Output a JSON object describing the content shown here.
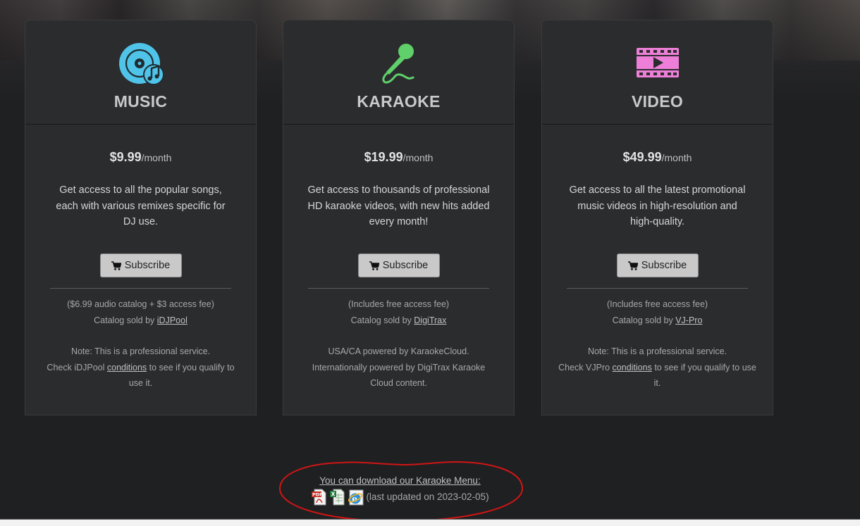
{
  "plans": [
    {
      "title": "MUSIC",
      "icon": "vinyl-music-icon",
      "price": "$9.99",
      "per": "/month",
      "description": "Get access to all the popular songs, each with various remixes specific for DJ use.",
      "subscribe_label": "Subscribe",
      "fee_note": "($6.99 audio catalog + $3 access fee)",
      "sold_by_prefix": "Catalog sold by ",
      "sold_by_link": "iDJPool",
      "note_line1": "Note: This is a professional service.",
      "note_line2_prefix": "Check iDJPool ",
      "note_link": "conditions",
      "note_line2_suffix": " to see if you qualify to use it."
    },
    {
      "title": "KARAOKE",
      "icon": "microphone-icon",
      "price": "$19.99",
      "per": "/month",
      "description": "Get access to thousands of professional HD karaoke videos, with new hits added every month!",
      "subscribe_label": "Subscribe",
      "fee_note": "(Includes free access fee)",
      "sold_by_prefix": "Catalog sold by ",
      "sold_by_link": "DigiTrax",
      "note_text": "USA/CA powered by KaraokeCloud. Internationally powered by DigiTrax Karaoke Cloud content."
    },
    {
      "title": "VIDEO",
      "icon": "film-play-icon",
      "price": "$49.99",
      "per": "/month",
      "description": "Get access to all the latest promotional music videos in high-resolution and high-quality.",
      "subscribe_label": "Subscribe",
      "fee_note": "(Includes free access fee)",
      "sold_by_prefix": "Catalog sold by ",
      "sold_by_link": "VJ-Pro",
      "note_line1": "Note: This is a professional service.",
      "note_line2_prefix": "Check VJPro ",
      "note_link": "conditions",
      "note_line2_suffix": " to see if you qualify to use it."
    }
  ],
  "download": {
    "link_text": "You can download our Karaoke Menu:",
    "updated_text": "(last updated on 2023-02-05)",
    "files": [
      "pdf-file-icon",
      "excel-file-icon",
      "internet-explorer-icon"
    ]
  },
  "colors": {
    "music_icon": "#4fc3e8",
    "karaoke_icon": "#5fd06a",
    "video_icon": "#ee7fd8",
    "annotation_circle": "#d01515"
  }
}
